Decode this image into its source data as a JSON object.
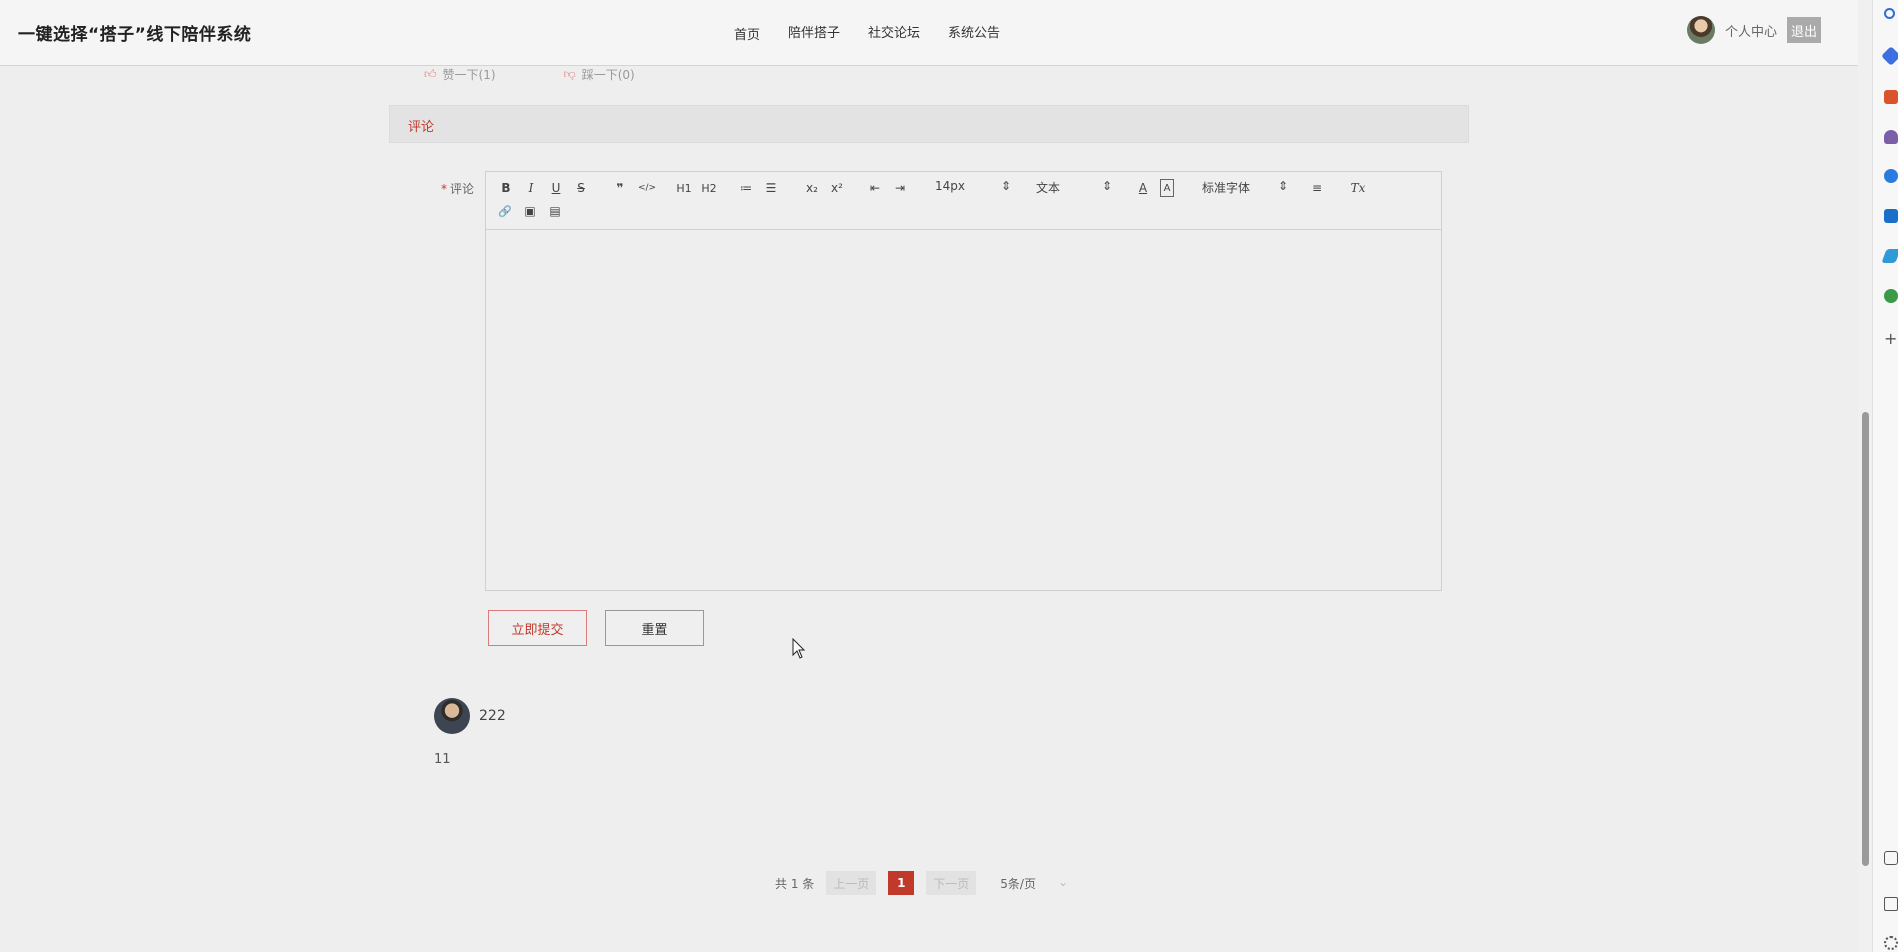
{
  "header": {
    "title": "一键选择“搭子”线下陪伴系统",
    "nav": [
      "首页",
      "陪伴搭子",
      "社交论坛",
      "系统公告"
    ],
    "user_center": "个人中心",
    "logout": "退出"
  },
  "likes": {
    "like": "赞一下(1)",
    "dislike": "踩一下(0)"
  },
  "section": {
    "title": "评论"
  },
  "form": {
    "required_mark": "*",
    "label": "评论",
    "toolbar": {
      "bold": "B",
      "italic": "I",
      "underline": "U",
      "strike": "S",
      "quote": "❞",
      "code": "</>",
      "h1": "H1",
      "h2": "H2",
      "ordered": "≔",
      "bullet": "☰",
      "sub": "x₂",
      "sup": "x²",
      "outdent": "⇤",
      "indent": "⇥",
      "size": "14px",
      "format": "文本",
      "font_color": "A",
      "bg_color": "A",
      "font": "标准字体",
      "align": "≡",
      "clean": "Tx",
      "link": "🔗",
      "image": "▣",
      "video": "▤",
      "select_arrow": "⇕"
    },
    "submit": "立即提交",
    "reset": "重置"
  },
  "comments": [
    {
      "user": "222",
      "text": "11"
    }
  ],
  "pagination": {
    "total": "共 1 条",
    "prev": "上一页",
    "current": "1",
    "next": "下一页",
    "page_size": "5条/页",
    "dropdown_icon": "⌄"
  }
}
